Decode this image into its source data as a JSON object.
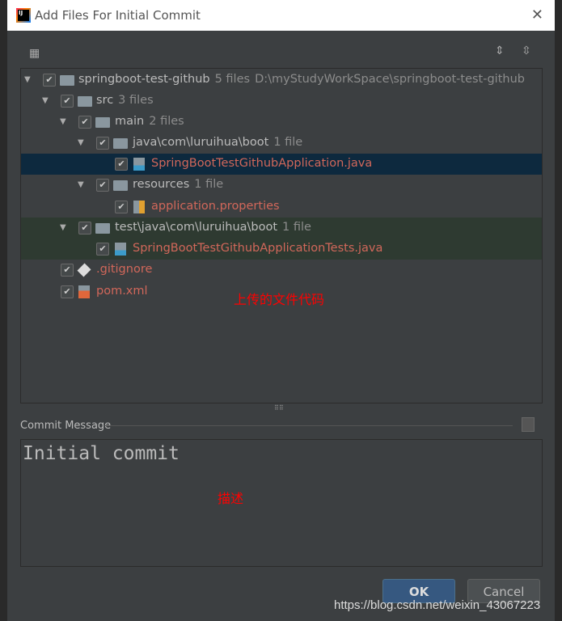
{
  "window": {
    "title": "Add Files For Initial Commit",
    "close_icon": "close-icon"
  },
  "tree": {
    "root": {
      "name": "springboot-test-github",
      "count": "5 files",
      "path": "D:\\myStudyWorkSpace\\springboot-test-github"
    },
    "src": {
      "name": "src",
      "count": "3 files"
    },
    "main": {
      "name": "main",
      "count": "2 files"
    },
    "java": {
      "name": "java\\com\\luruihua\\boot",
      "count": "1 file"
    },
    "app": {
      "name": "SpringBootTestGithubApplication.java"
    },
    "resources": {
      "name": "resources",
      "count": "1 file"
    },
    "props": {
      "name": "application.properties"
    },
    "test": {
      "name": "test\\java\\com\\luruihua\\boot",
      "count": "1 file"
    },
    "tests": {
      "name": "SpringBootTestGithubApplicationTests.java"
    },
    "gitignore": {
      "name": ".gitignore"
    },
    "pom": {
      "name": "pom.xml"
    }
  },
  "annotations": {
    "files": "上传的文件代码",
    "desc": "描述"
  },
  "commit": {
    "label": "Commit Message",
    "value": "Initial commit"
  },
  "buttons": {
    "ok": "OK",
    "cancel": "Cancel"
  },
  "watermark": "https://blog.csdn.net/weixin_43067223",
  "colors": {
    "selected": "#0d293e",
    "unversioned": "#d1675a",
    "ok": "#365880"
  }
}
